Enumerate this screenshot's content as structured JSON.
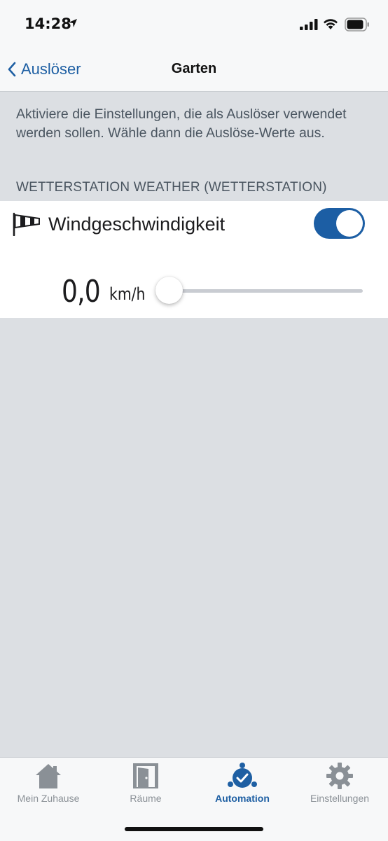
{
  "status_bar": {
    "time": "14:28",
    "icons": [
      "location-arrow-icon",
      "cellular-signal-icon",
      "wifi-icon",
      "battery-icon"
    ]
  },
  "nav": {
    "back_label": "Auslöser",
    "title": "Garten"
  },
  "info_text": "Aktiviere die Einstellungen, die als Auslöser verwendet werden sollen. Wähle dann die Auslöse-Werte aus.",
  "section_header": "WETTERSTATION WEATHER (WETTERSTATION)",
  "trigger": {
    "icon": "windsock-icon",
    "label": "Windgeschwindigkeit",
    "enabled": true,
    "value": "0,0",
    "unit": "km/h",
    "slider_fraction": 0
  },
  "tabs": [
    {
      "label": "Mein Zuhause",
      "icon": "home-icon",
      "active": false
    },
    {
      "label": "Räume",
      "icon": "door-icon",
      "active": false
    },
    {
      "label": "Automation",
      "icon": "automation-icon",
      "active": true
    },
    {
      "label": "Einstellungen",
      "icon": "gear-icon",
      "active": false
    }
  ],
  "colors": {
    "accent": "#1e5fa3",
    "toggle_on": "#1c5ea4",
    "background": "#dcdfe3",
    "inactive_tab": "#8a9096"
  }
}
